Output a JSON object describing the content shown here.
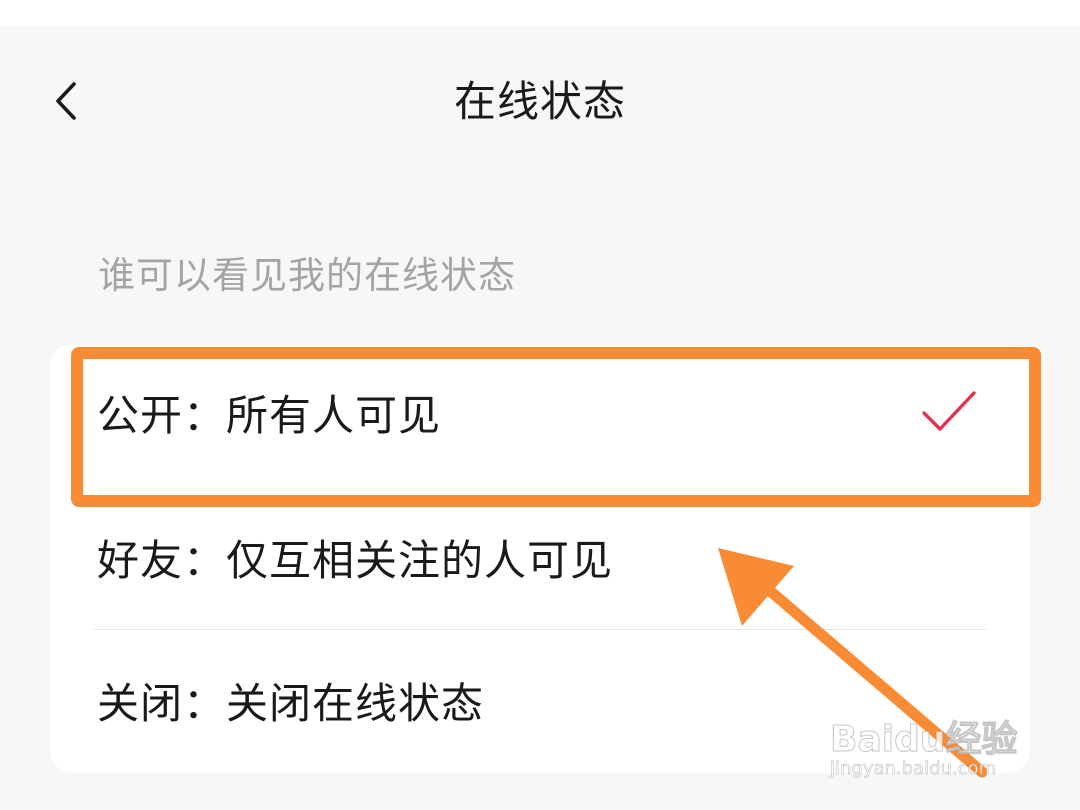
{
  "header": {
    "back_icon": "chevron-left-icon",
    "title": "在线状态"
  },
  "section": {
    "label": "谁可以看见我的在线状态"
  },
  "options": [
    {
      "label": "公开：所有人可见",
      "selected": true
    },
    {
      "label": "好友：仅互相关注的人可见",
      "selected": false
    },
    {
      "label": "关闭：关闭在线状态",
      "selected": false
    }
  ],
  "colors": {
    "check": "#e0344f",
    "annotation": "#f98b35",
    "background": "#f7f7f7",
    "card": "#ffffff",
    "section_label": "#a4a4a4"
  },
  "icons": {
    "selected": "checkmark-icon"
  },
  "watermark": {
    "brand": "Baidu经验",
    "url": "jingyan.baidu.com"
  }
}
